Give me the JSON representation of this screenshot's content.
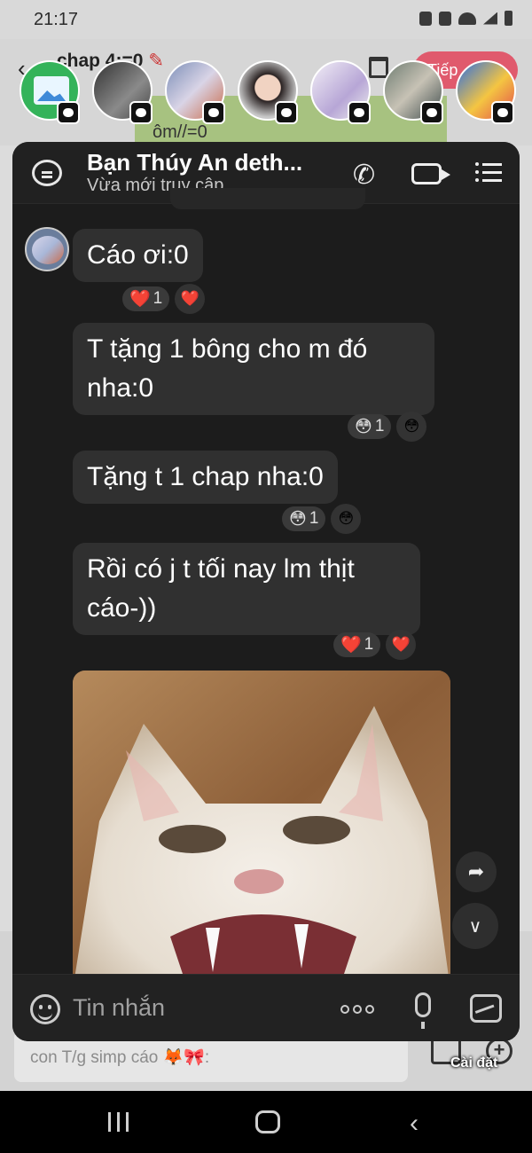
{
  "status_bar": {
    "time": "21:17"
  },
  "background_chat": {
    "title": "chap 4:=0",
    "next_button": "Tiếp",
    "snippet_line": "ôm//=0",
    "composer_text": "con T/g simp cáo 🦊🎀:",
    "settings_label": "Cài đặt"
  },
  "chat_head": {
    "contact_name": "Bạn Thúy An deth...",
    "status": "Vừa mới truy cập",
    "icons": [
      "chat-icon",
      "phone-icon",
      "video-call-icon",
      "menu-icon"
    ]
  },
  "messages": [
    {
      "text": "Cáo ơi:0",
      "reaction": "❤️",
      "count": "1",
      "react_btn": "❤️"
    },
    {
      "text": "T tặng 1 bông cho m đó nha:0",
      "reaction": "😳",
      "count": "1",
      "react_btn": "😳"
    },
    {
      "text": "Tặng t 1 chap nha:0",
      "reaction": "😳",
      "count": "1",
      "react_btn": "😳"
    },
    {
      "text": "Rồi có j t tối nay lm thịt cáo-))",
      "reaction": "❤️",
      "count": "1",
      "react_btn": "❤️"
    }
  ],
  "composer": {
    "placeholder": "Tin nhắn"
  },
  "colors": {
    "panel_bg": "#1c1c1c",
    "bubble_bg": "#303030",
    "next_button": "#e05a6d",
    "accent_green": "#a7c280"
  }
}
